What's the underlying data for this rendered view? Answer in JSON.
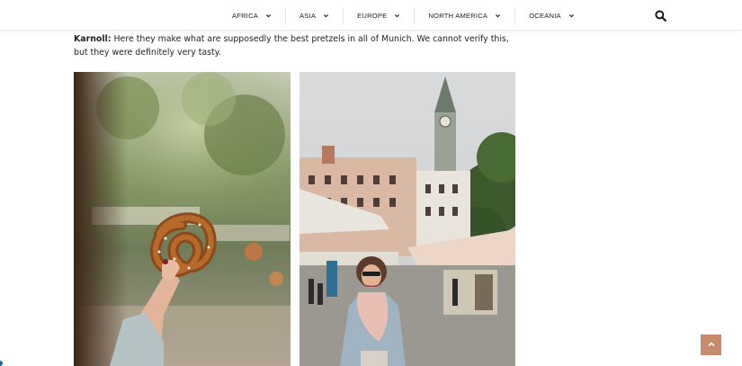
{
  "nav": {
    "items": [
      {
        "label": "AFRICA"
      },
      {
        "label": "ASIA"
      },
      {
        "label": "EUROPE"
      },
      {
        "label": "NORTH AMERICA"
      },
      {
        "label": "OCEANIA"
      }
    ],
    "search_icon": "search-icon",
    "chevron_icon": "chevron-down-icon"
  },
  "article": {
    "speaker": "Karnoll:",
    "text": " Here they make what are supposedly the best pretzels in all of Munich. We cannot verify this, but they were definitely very tasty."
  },
  "photos": [
    {
      "subject": "pretzel-held-in-hand"
    },
    {
      "subject": "woman-at-munich-market"
    }
  ],
  "back_to_top": {
    "icon": "chevron-up-icon"
  },
  "colors": {
    "accent": "#c88a6d",
    "text": "#222222"
  }
}
